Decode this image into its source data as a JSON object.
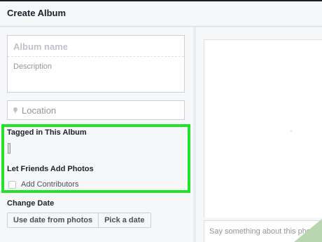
{
  "header": {
    "title": "Create Album"
  },
  "form": {
    "album_name_placeholder": "Album name",
    "description_placeholder": "Description",
    "location_placeholder": "Location"
  },
  "tagged": {
    "label": "Tagged in This Album"
  },
  "friends": {
    "label": "Let Friends Add Photos",
    "checkbox_label": "Add Contributors",
    "checked": false
  },
  "date": {
    "label": "Change Date",
    "buttons": [
      "Use date from photos",
      "Pick a date"
    ]
  },
  "photo": {
    "caption_placeholder": "Say something about this photo"
  },
  "colors": {
    "highlight": "#22e32a",
    "panel": "#f6f7f9",
    "background": "#e9ebee"
  },
  "icons": {
    "location": "map-pin-icon"
  }
}
